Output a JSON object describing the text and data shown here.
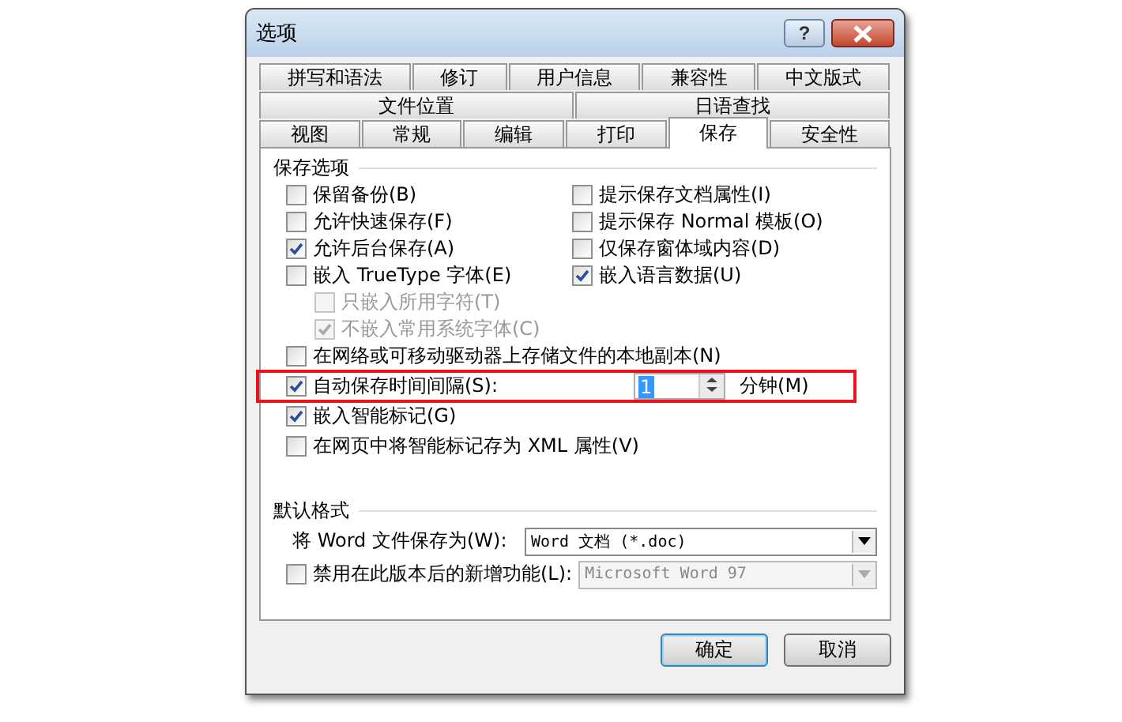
{
  "window": {
    "title": "选项",
    "help_button": "?"
  },
  "tab_rows": [
    [
      {
        "label": "拼写和语法",
        "selected": false
      },
      {
        "label": "修订",
        "selected": false
      },
      {
        "label": "用户信息",
        "selected": false
      },
      {
        "label": "兼容性",
        "selected": false
      },
      {
        "label": "中文版式",
        "selected": false
      }
    ],
    [
      {
        "label": "文件位置",
        "selected": false
      },
      {
        "label": "日语查找",
        "selected": false
      }
    ],
    [
      {
        "label": "视图",
        "selected": false
      },
      {
        "label": "常规",
        "selected": false
      },
      {
        "label": "编辑",
        "selected": false
      },
      {
        "label": "打印",
        "selected": false
      },
      {
        "label": "保存",
        "selected": true
      },
      {
        "label": "安全性",
        "selected": false
      }
    ]
  ],
  "save_options": {
    "title": "保存选项",
    "left": [
      {
        "label": "保留备份(B)",
        "checked": false,
        "disabled": false
      },
      {
        "label": "允许快速保存(F)",
        "checked": false,
        "disabled": false
      },
      {
        "label": "允许后台保存(A)",
        "checked": true,
        "disabled": false
      },
      {
        "label": "嵌入 TrueType 字体(E)",
        "checked": false,
        "disabled": false,
        "children": [
          {
            "label": "只嵌入所用字符(T)",
            "checked": false,
            "disabled": true
          },
          {
            "label": "不嵌入常用系统字体(C)",
            "checked": true,
            "disabled": true
          }
        ]
      }
    ],
    "right": [
      {
        "label": "提示保存文档属性(I)",
        "checked": false,
        "disabled": false
      },
      {
        "label": "提示保存 Normal 模板(O)",
        "checked": false,
        "disabled": false
      },
      {
        "label": "仅保存窗体域内容(D)",
        "checked": false,
        "disabled": false
      },
      {
        "label": "嵌入语言数据(U)",
        "checked": true,
        "disabled": false
      }
    ],
    "full": [
      {
        "kind": "checkbox",
        "label": "在网络或可移动驱动器上存储文件的本地副本(N)",
        "checked": false,
        "highlighted": false
      },
      {
        "kind": "spin",
        "label": "自动保存时间间隔(S):",
        "checked": true,
        "value": "1",
        "unit": "分钟(M)",
        "highlighted": true
      },
      {
        "kind": "checkbox",
        "label": "嵌入智能标记(G)",
        "checked": true,
        "highlighted": false
      },
      {
        "kind": "checkbox",
        "label": "在网页中将智能标记存为 XML 属性(V)",
        "checked": false,
        "highlighted": false
      }
    ]
  },
  "default_format": {
    "title": "默认格式",
    "save_as_label": "将 Word 文件保存为(W):",
    "save_as_value": "Word 文档 (*.doc)",
    "disable_label": "禁用在此版本后的新增功能(L):",
    "disable_checked": false,
    "disable_value": "Microsoft Word 97"
  },
  "buttons": [
    {
      "label": "确定",
      "selected": true
    },
    {
      "label": "取消",
      "selected": false
    }
  ]
}
